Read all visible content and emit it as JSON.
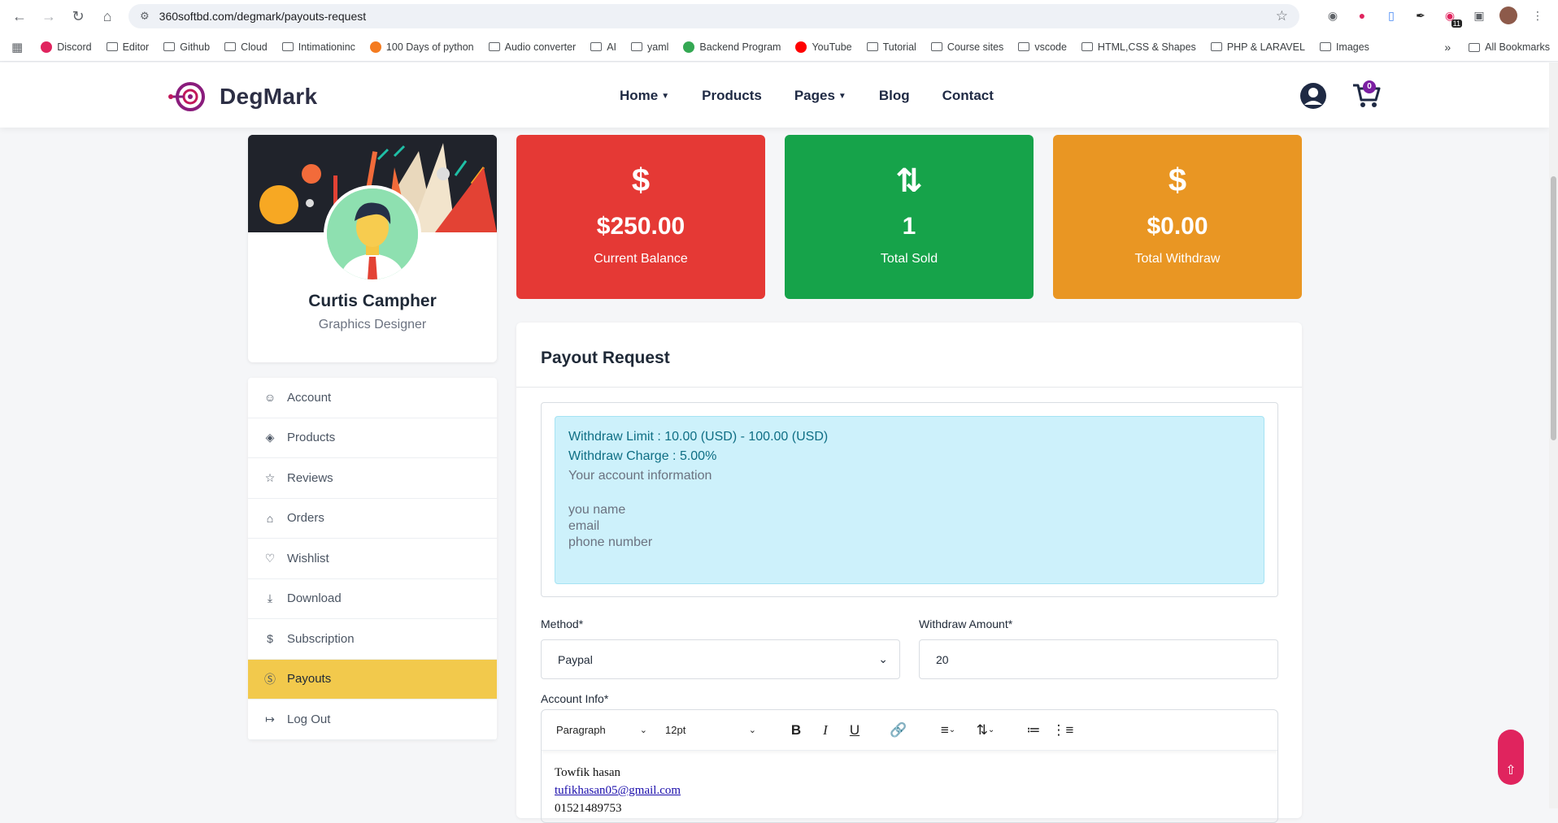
{
  "browser": {
    "url": "360softbd.com/degmark/payouts-request",
    "ext_badge": "11",
    "bookmarks": [
      {
        "label": "Discord",
        "type": "fav",
        "color": "#e0245e"
      },
      {
        "label": "Editor",
        "type": "folder"
      },
      {
        "label": "Github",
        "type": "folder"
      },
      {
        "label": "Cloud",
        "type": "folder"
      },
      {
        "label": "Intimationinc",
        "type": "folder"
      },
      {
        "label": "100 Days of python",
        "type": "fav",
        "color": "#f47b20"
      },
      {
        "label": "Audio converter",
        "type": "folder"
      },
      {
        "label": "AI",
        "type": "folder"
      },
      {
        "label": "yaml",
        "type": "folder"
      },
      {
        "label": "Backend Program",
        "type": "fav",
        "color": "#34a853"
      },
      {
        "label": "YouTube",
        "type": "fav",
        "color": "#ff0000"
      },
      {
        "label": "Tutorial",
        "type": "folder"
      },
      {
        "label": "Course sites",
        "type": "folder"
      },
      {
        "label": "vscode",
        "type": "folder"
      },
      {
        "label": "HTML,CSS & Shapes",
        "type": "folder"
      },
      {
        "label": "PHP & LARAVEL",
        "type": "folder"
      },
      {
        "label": "Images",
        "type": "folder"
      }
    ],
    "all_bookmarks": "All Bookmarks"
  },
  "header": {
    "logo_text": "DegMark",
    "nav": [
      {
        "label": "Home",
        "dropdown": true
      },
      {
        "label": "Products",
        "dropdown": false
      },
      {
        "label": "Pages",
        "dropdown": true
      },
      {
        "label": "Blog",
        "dropdown": false
      },
      {
        "label": "Contact",
        "dropdown": false
      }
    ],
    "cart_count": "0"
  },
  "profile": {
    "name": "Curtis Campher",
    "role": "Graphics Designer"
  },
  "side_menu": [
    {
      "label": "Account",
      "icon": "user-icon",
      "active": false
    },
    {
      "label": "Products",
      "icon": "layers-icon",
      "active": false
    },
    {
      "label": "Reviews",
      "icon": "star-icon",
      "active": false
    },
    {
      "label": "Orders",
      "icon": "basket-icon",
      "active": false
    },
    {
      "label": "Wishlist",
      "icon": "heart-icon",
      "active": false
    },
    {
      "label": "Download",
      "icon": "download-icon",
      "active": false
    },
    {
      "label": "Subscription",
      "icon": "dollar-icon",
      "active": false
    },
    {
      "label": "Payouts",
      "icon": "coin-icon",
      "active": true
    },
    {
      "label": "Log Out",
      "icon": "logout-icon",
      "active": false
    }
  ],
  "stats": [
    {
      "icon": "dollar-icon",
      "value": "$250.00",
      "label": "Current Balance",
      "color": "#e53935"
    },
    {
      "icon": "sort-icon",
      "value": "1",
      "label": "Total Sold",
      "color": "#16a34a"
    },
    {
      "icon": "dollar-icon",
      "value": "$0.00",
      "label": "Total Withdraw",
      "color": "#e99623"
    }
  ],
  "payout": {
    "title": "Payout Request",
    "limit": "Withdraw Limit : 10.00 (USD) - 100.00 (USD)",
    "charge": "Withdraw Charge : 5.00%",
    "account_info_heading": "Your account information",
    "info_lines": [
      "you name",
      "email",
      "phone number"
    ],
    "method_label": "Method*",
    "method_value": "Paypal",
    "amount_label": "Withdraw Amount*",
    "amount_value": "20",
    "account_info_label": "Account Info*",
    "toolbar": {
      "block_format": "Paragraph",
      "font_size": "12pt"
    },
    "editor_lines": [
      "Towfik hasan",
      "tufikhasan05@gmail.com",
      "01521489753"
    ]
  }
}
